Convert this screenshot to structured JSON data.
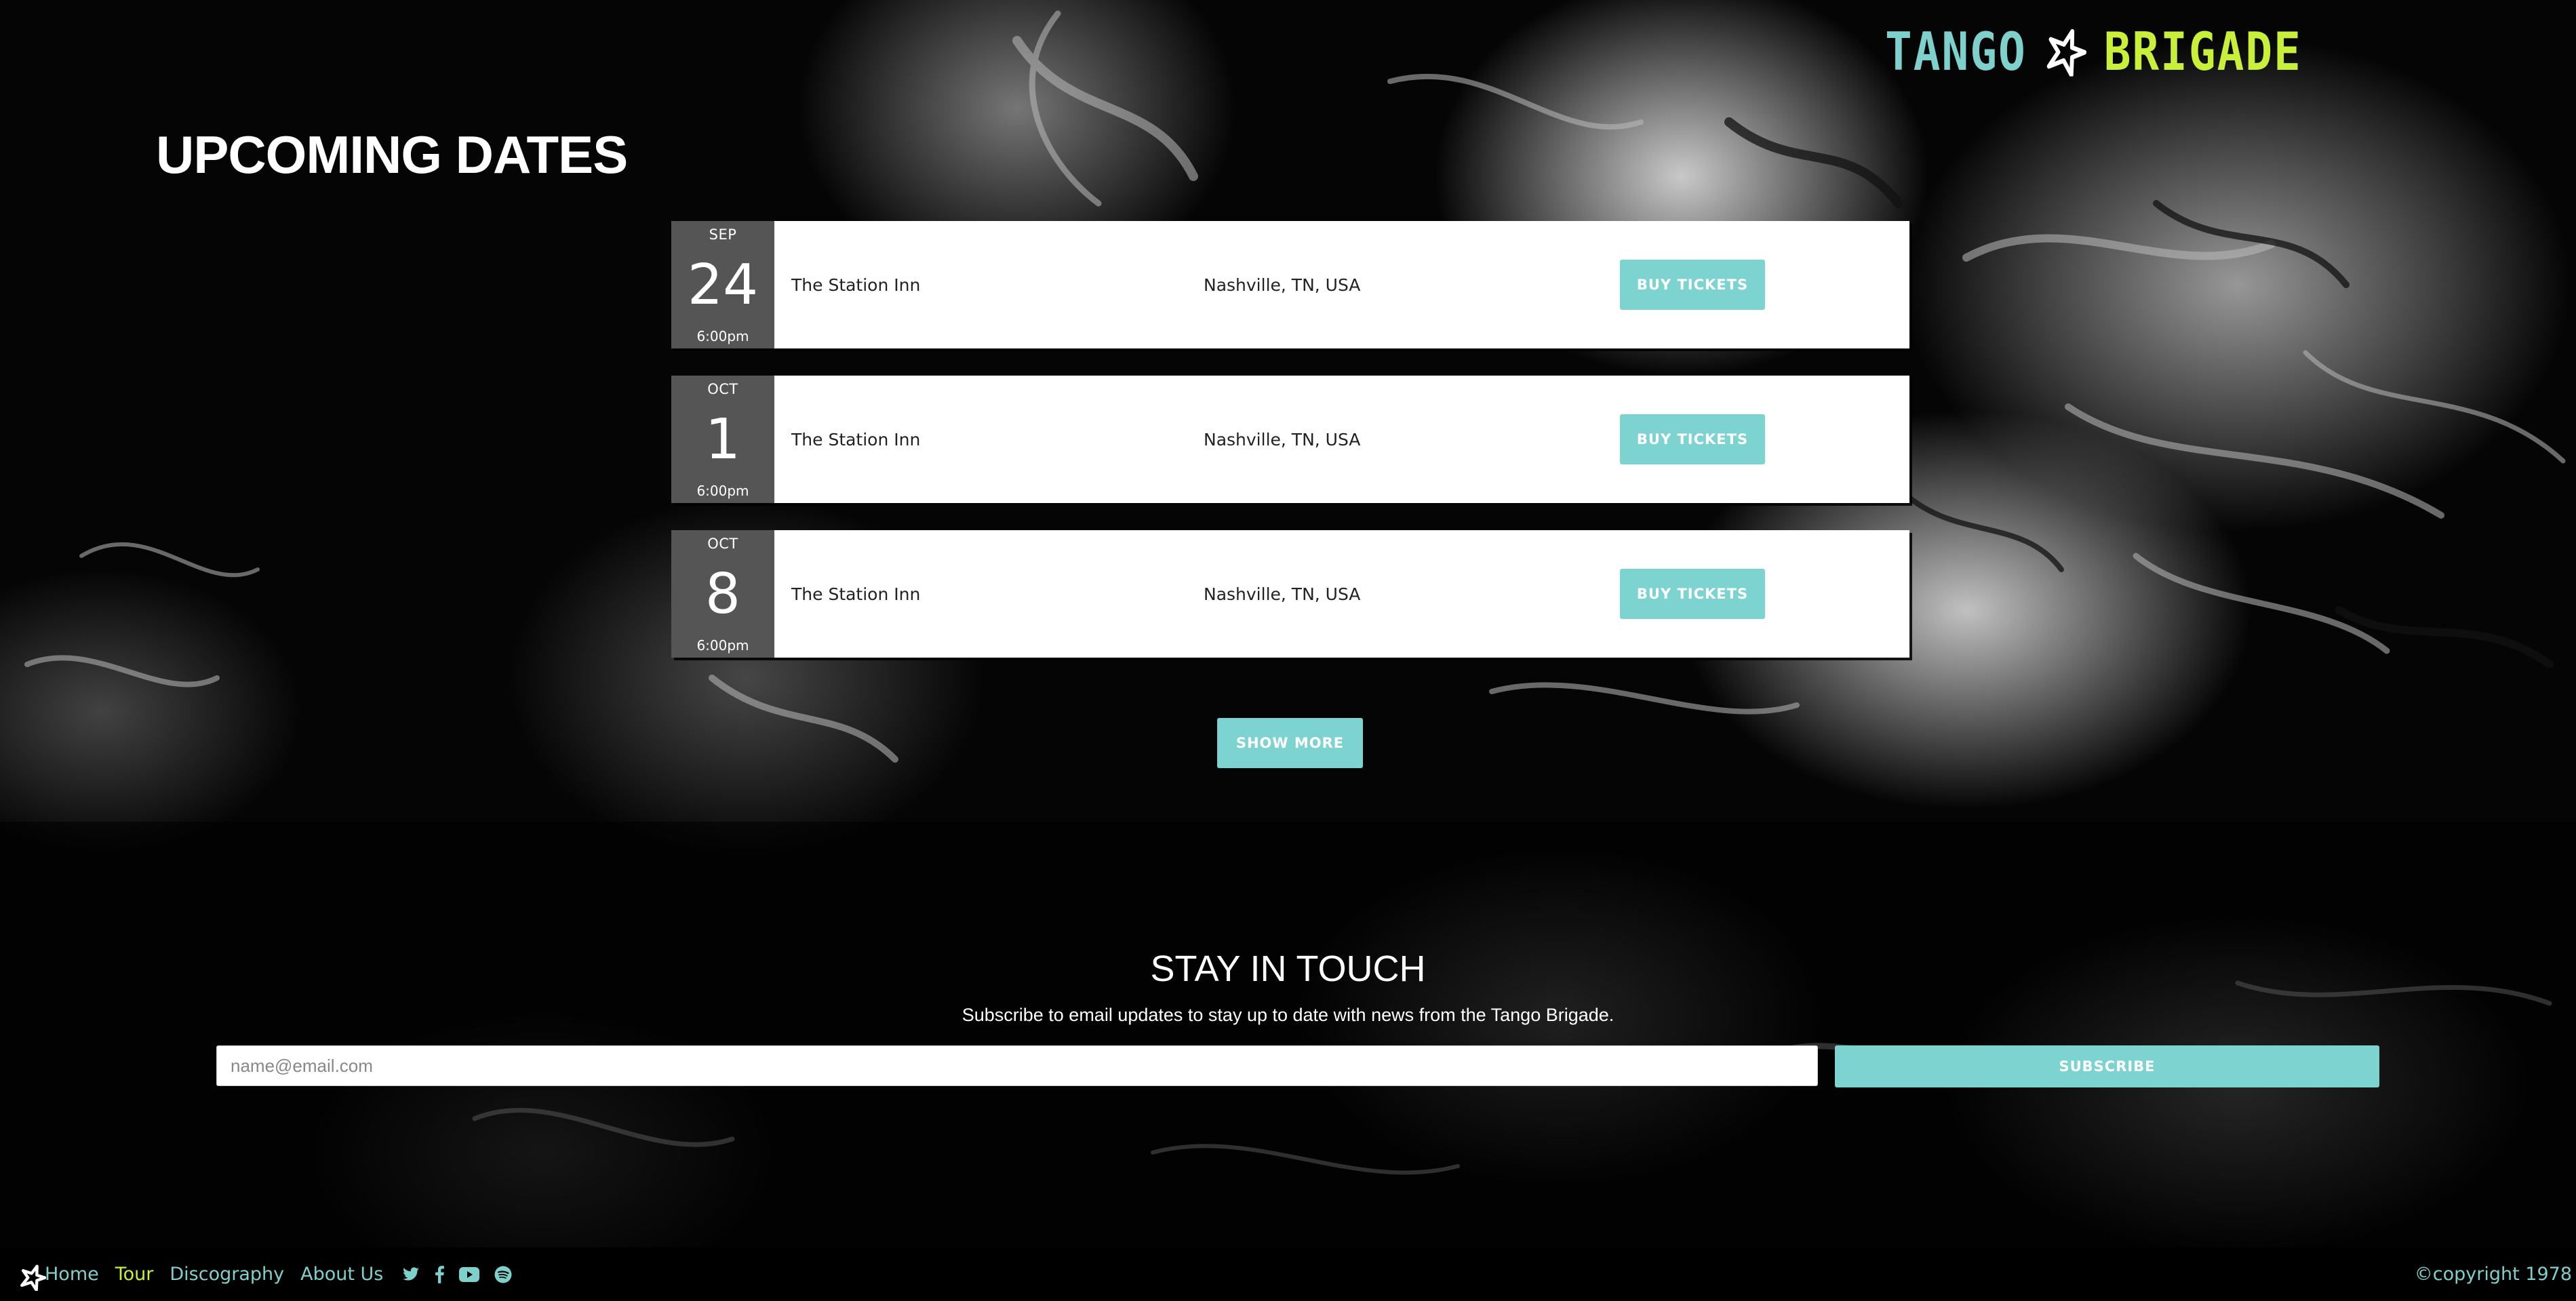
{
  "brand": {
    "logo_word_1": "TANGO",
    "logo_word_2": "BRIGADE",
    "accent_color": "#7ed0cc",
    "highlight_color": "#c8ef3a"
  },
  "tour": {
    "title": "UPCOMING DATES",
    "dates": [
      {
        "month": "SEP",
        "day": "24",
        "time": "6:00pm",
        "venue": "The Station Inn",
        "location": "Nashville, TN, USA",
        "button": "BUY TICKETS"
      },
      {
        "month": "OCT",
        "day": "1",
        "time": "6:00pm",
        "venue": "The Station Inn",
        "location": "Nashville, TN, USA",
        "button": "BUY TICKETS"
      },
      {
        "month": "OCT",
        "day": "8",
        "time": "6:00pm",
        "venue": "The Station Inn",
        "location": "Nashville, TN, USA",
        "button": "BUY TICKETS"
      }
    ],
    "show_more_label": "SHOW MORE"
  },
  "signup": {
    "title": "STAY IN TOUCH",
    "text": "Subscribe to email updates to stay up to date with news from the Tango Brigade.",
    "placeholder": "name@email.com",
    "button": "SUBSCRIBE"
  },
  "footer": {
    "nav": [
      {
        "label": "Home",
        "active": false
      },
      {
        "label": "Tour",
        "active": true
      },
      {
        "label": "Discography",
        "active": false
      },
      {
        "label": "About Us",
        "active": false
      }
    ],
    "social_icons": [
      "twitter-icon",
      "facebook-icon",
      "youtube-icon",
      "spotify-icon"
    ],
    "copyright": "©copyright 1978"
  }
}
